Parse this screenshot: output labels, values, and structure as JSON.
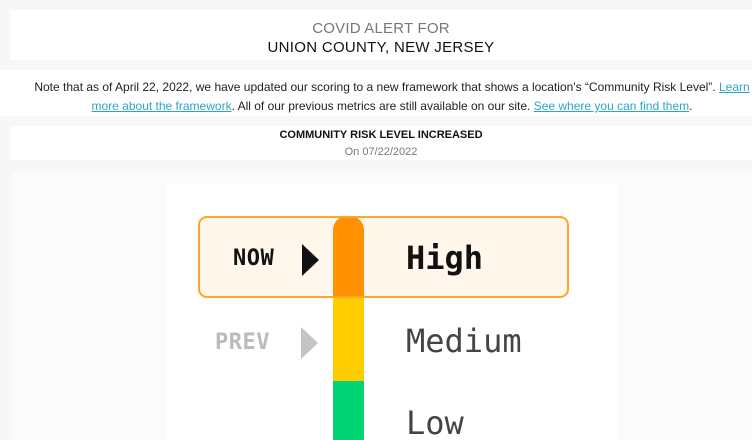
{
  "header": {
    "title": "COVID ALERT FOR",
    "location": "UNION COUNTY, NEW JERSEY"
  },
  "note": {
    "text_before": "Note that as of April 22, 2022, we have updated our scoring to a new framework that shows a location's “Community Risk Level”. ",
    "link1_line1": "Learn",
    "link1_line2": "more about the framework",
    "text_middle": ". All of our previous metrics are still available on our site. ",
    "link2": "See where you can find them",
    "text_end": "."
  },
  "alert": {
    "title": "COMMUNITY RISK LEVEL INCREASED",
    "date": "On 07/22/2022"
  },
  "risk": {
    "now_label": "NOW",
    "prev_label": "PREV",
    "levels": [
      "High",
      "Medium",
      "Low"
    ],
    "current": "High",
    "previous": "Medium",
    "colors": {
      "high": "#ff9000",
      "medium": "#ffcc00",
      "low": "#00d474",
      "highlight_border": "#ffa528",
      "link": "#2ba6cb"
    }
  }
}
